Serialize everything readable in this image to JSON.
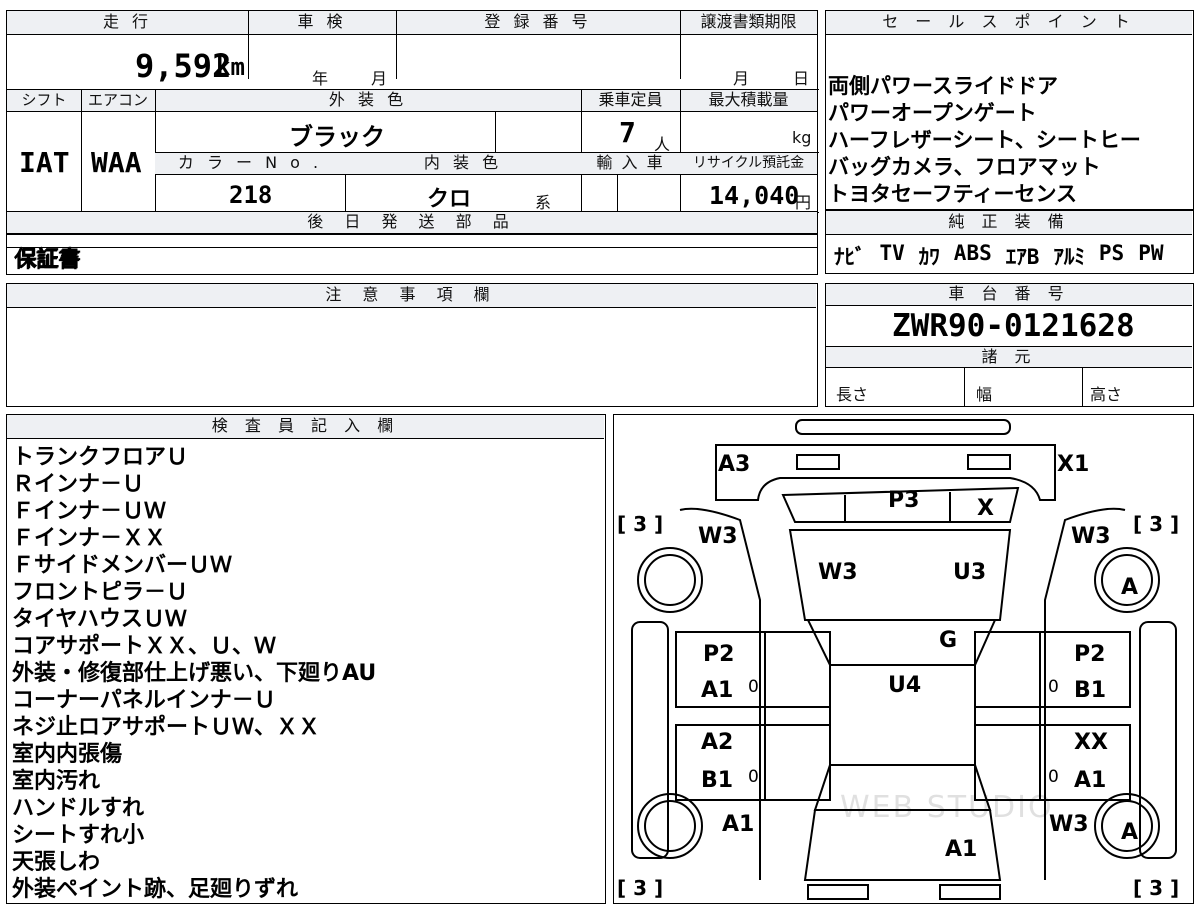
{
  "top_block": {
    "headers": {
      "mileage": "走 行",
      "inspection": "車 検",
      "registration": "登 録 番 号",
      "transfer_deadline": "譲渡書類期限",
      "shift": "シフト",
      "aircon": "エアコン",
      "exterior_color": "外 装 色",
      "capacity": "乗車定員",
      "max_load": "最大積載量",
      "color_no": "カ ラ ー N o .",
      "interior_color": "内 装 色",
      "import": "輸 入 車",
      "recycle_fee": "リサイクル預託金",
      "deferred_parts": "後 日 発 送 部 品",
      "notes": "注 意 事 項 欄"
    },
    "values": {
      "mileage": "9,592",
      "mileage_unit": "km",
      "inspection_year": "年",
      "inspection_month": "月",
      "transfer_month": "月",
      "transfer_day": "日",
      "shift": "IAT",
      "aircon": "WAA",
      "exterior_color": "ブラック",
      "capacity": "7",
      "capacity_unit": "人",
      "max_load_unit": "kg",
      "color_no": "218",
      "interior_color": "クロ",
      "interior_suffix": "系",
      "recycle_fee": "14,040",
      "recycle_unit": "円",
      "deferred_parts": "保証書"
    }
  },
  "right_block": {
    "sales_header": "セ ー ル ス ポ イ ン ト",
    "sales_points": [
      "両側パワースライドドア",
      "パワーオープンゲート",
      "ハーフレザーシート、シートヒー",
      "バッグカメラ、フロアマット",
      "トヨタセーフティーセンス"
    ],
    "equipment_header": "純 正 装 備",
    "equipment": [
      "ﾅﾋﾞ",
      "TV",
      "ｶﾜ",
      "ABS",
      "ｴｱB",
      "ｱﾙﾐ",
      "PS",
      "PW"
    ],
    "chassis_header": "車 台 番 号",
    "chassis_number": "ZWR90-0121628",
    "specs_header": "諸 元",
    "specs": [
      "長さ",
      "幅",
      "高さ"
    ]
  },
  "inspector": {
    "header": "検 査 員 記 入 欄",
    "notes": [
      "トランクフロアＵ",
      "Ｒインナ－Ｕ",
      "Ｆインナ－ＵＷ",
      "Ｆインナ－ＸＸ",
      "ＦサイドメンバーＵＷ",
      "フロントピラ－Ｕ",
      "タイヤハウスＵＷ",
      "コアサポートＸＸ、Ｕ、Ｗ",
      "外装・修復部仕上げ悪い、下廻りAU",
      "コーナーパネルインナ－Ｕ",
      "ネジ止ロアサポートＵＷ、ＸＸ",
      "室内内張傷",
      "室内汚れ",
      "ハンドルすれ",
      "シートすれ小",
      "天張しわ",
      "外装ペイント跡、足廻りずれ"
    ]
  },
  "diagram": {
    "marks": {
      "rear_left": "A3",
      "rear_right": "X1",
      "rear_panel": "P3",
      "rear_glass": "X",
      "quarter_left": "W3",
      "quarter_right": "W3",
      "roof_left": "W3",
      "roof_right": "U3",
      "tire_rear_right": "A",
      "sunroof": "G",
      "door_rl_top": "P2",
      "door_rl_bottom": "A1",
      "door_rr_top": "P2",
      "door_rr_bottom": "B1",
      "center": "U4",
      "door_fl_top": "A2",
      "door_fl_bottom": "B1",
      "door_fr_top": "XX",
      "door_fr_bottom": "A1",
      "fender_left": "A1",
      "fender_right": "W3",
      "tire_front_right": "A",
      "hood": "A1",
      "zero": "0",
      "tire_bracket": "[ 3 ]"
    },
    "watermark": "WEB STUDIO"
  }
}
